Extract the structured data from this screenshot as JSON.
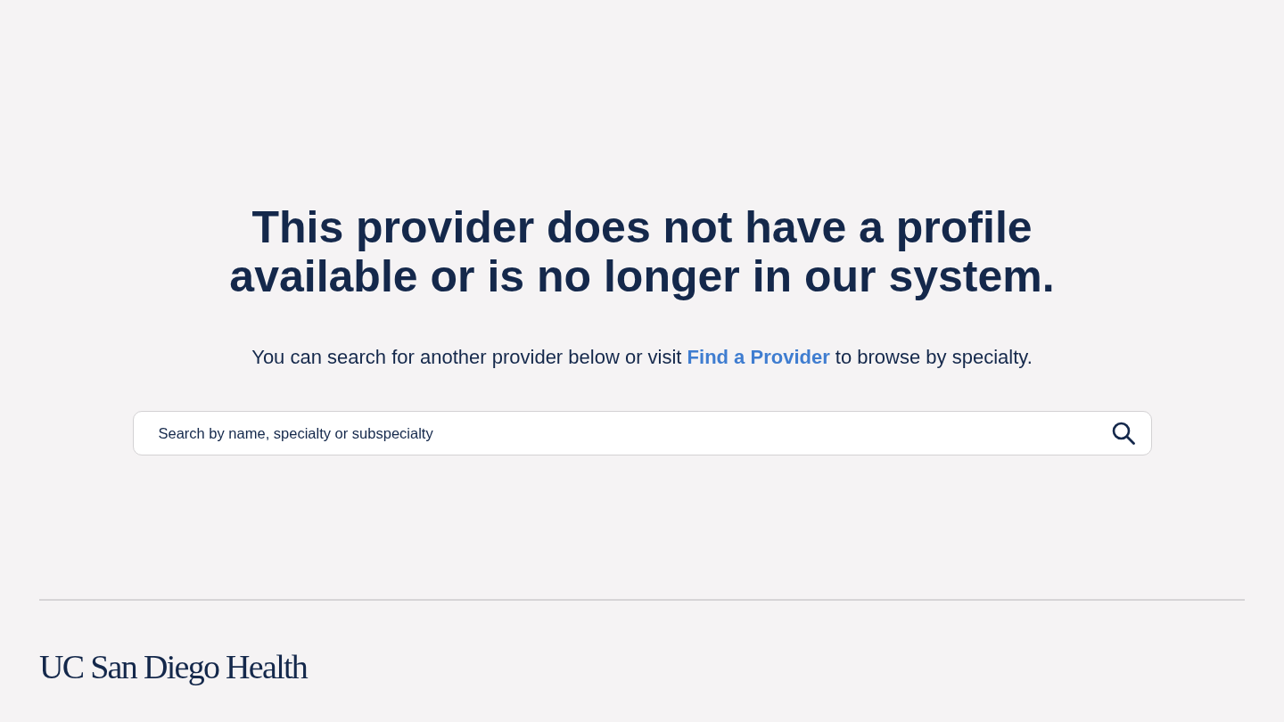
{
  "heading": {
    "lines": [
      "This provider does not have a profile",
      "available or is no longer in our system."
    ]
  },
  "message": {
    "before": "You can search for another provider below or visit",
    "link": "Find a Provider",
    "after": "to browse by specialty."
  },
  "search": {
    "placeholder": "Search by name, specialty or subspecialty"
  },
  "footer": {
    "logo": "UC San Diego Health"
  }
}
